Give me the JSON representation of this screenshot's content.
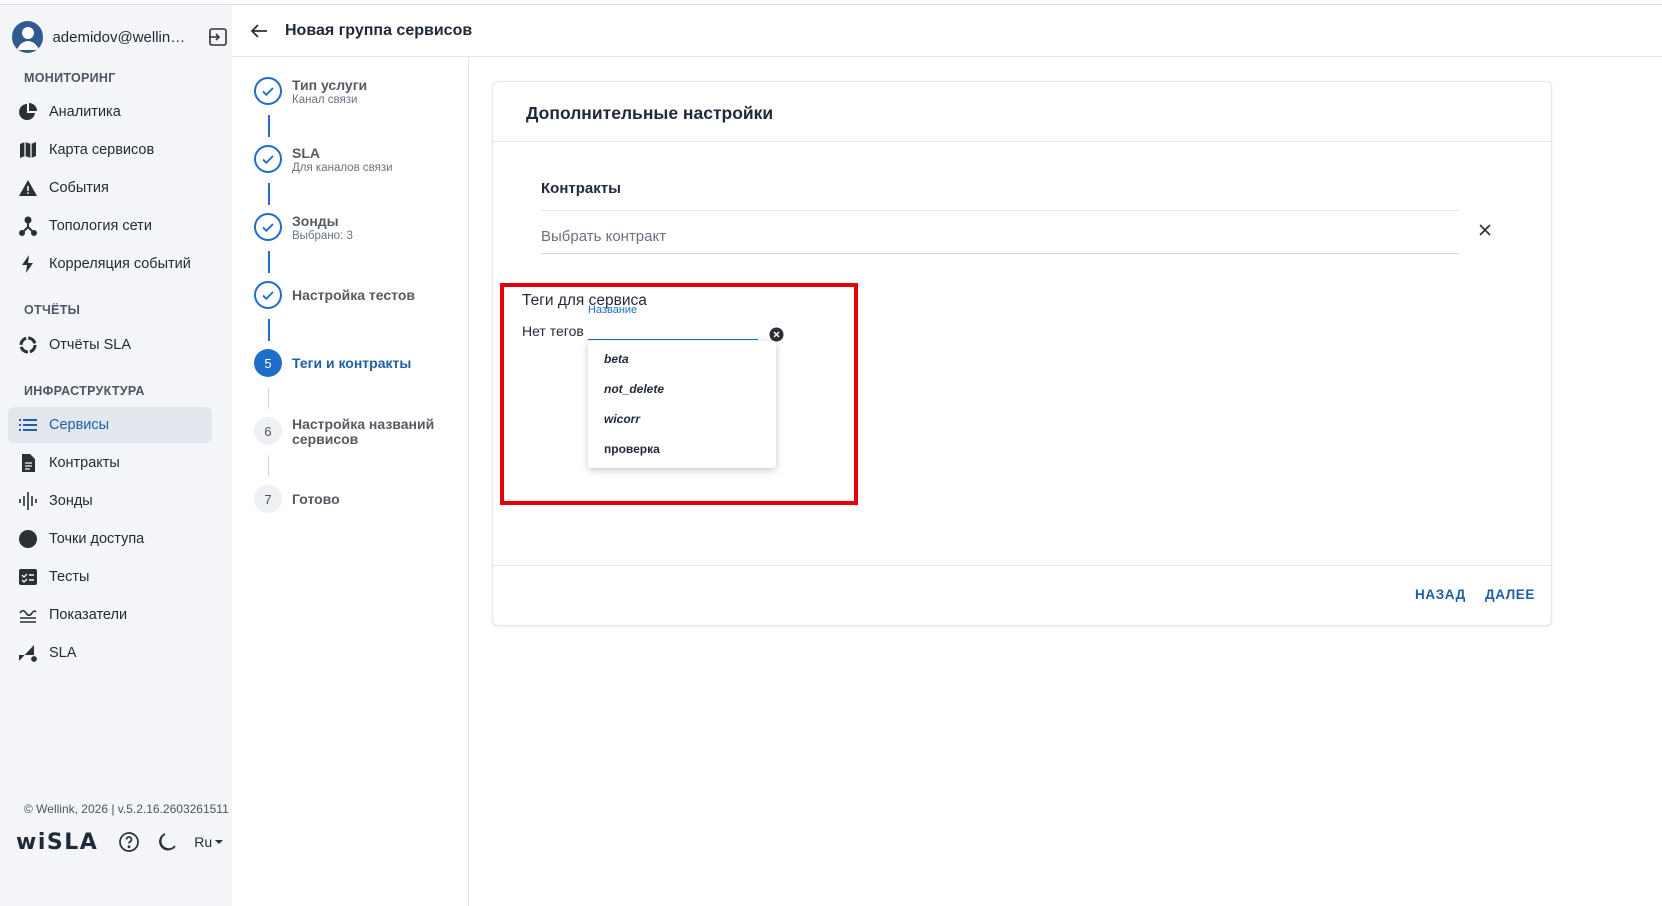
{
  "user": {
    "name": "ademidov@wellink..."
  },
  "sidebar": {
    "sections": [
      {
        "title": "МОНИТОРИНГ"
      },
      {
        "title": "ОТЧЁТЫ"
      },
      {
        "title": "ИНФРАСТРУКТУРА"
      }
    ],
    "items": [
      {
        "label": "Аналитика",
        "icon": "pie-chart-icon"
      },
      {
        "label": "Карта сервисов",
        "icon": "map-icon"
      },
      {
        "label": "События",
        "icon": "warning-icon"
      },
      {
        "label": "Топология сети",
        "icon": "topology-icon"
      },
      {
        "label": "Корреляция событий",
        "icon": "bolt-icon"
      },
      {
        "label": "Отчёты SLA",
        "icon": "ring-icon"
      },
      {
        "label": "Сервисы",
        "icon": "list-icon",
        "active": true
      },
      {
        "label": "Контракты",
        "icon": "document-icon"
      },
      {
        "label": "Зонды",
        "icon": "waveform-icon"
      },
      {
        "label": "Точки доступа",
        "icon": "circle-icon"
      },
      {
        "label": "Тесты",
        "icon": "checklist-icon"
      },
      {
        "label": "Показатели",
        "icon": "metrics-icon"
      },
      {
        "label": "SLA",
        "icon": "sla-icon"
      }
    ],
    "copyright": "© Wellink, 2026 | v.5.2.16.2603261511",
    "logo": "wiSLA",
    "language": "Ru"
  },
  "header": {
    "title": "Новая группа сервисов"
  },
  "stepper": {
    "steps": [
      {
        "title": "Тип услуги",
        "subtitle": "Канал связи",
        "state": "done"
      },
      {
        "title": "SLA",
        "subtitle": "Для каналов связи",
        "state": "done"
      },
      {
        "title": "Зонды",
        "subtitle": "Выбрано: 3",
        "state": "done"
      },
      {
        "title": "Настройка тестов",
        "subtitle": "",
        "state": "done"
      },
      {
        "title": "Теги и контракты",
        "subtitle": "",
        "state": "current",
        "number": "5"
      },
      {
        "title": "Настройка названий",
        "title2": "сервисов",
        "subtitle": "",
        "state": "todo",
        "number": "6"
      },
      {
        "title": "Готово",
        "subtitle": "",
        "state": "todo",
        "number": "7"
      }
    ]
  },
  "card": {
    "title": "Дополнительные настройки",
    "contracts_label": "Контракты",
    "contract_placeholder": "Выбрать контракт",
    "tags_title": "Теги для сервиса",
    "no_tags": "Нет тегов",
    "tag_input_label": "Название",
    "tag_options": [
      "beta",
      "not_delete",
      "wicorr",
      "проверка"
    ],
    "back_button": "НАЗАД",
    "next_button": "ДАЛЕЕ"
  },
  "colors": {
    "accent": "#1e6ec8",
    "highlight": "#e8000b",
    "sidebar_bg": "#f3f5f8"
  }
}
